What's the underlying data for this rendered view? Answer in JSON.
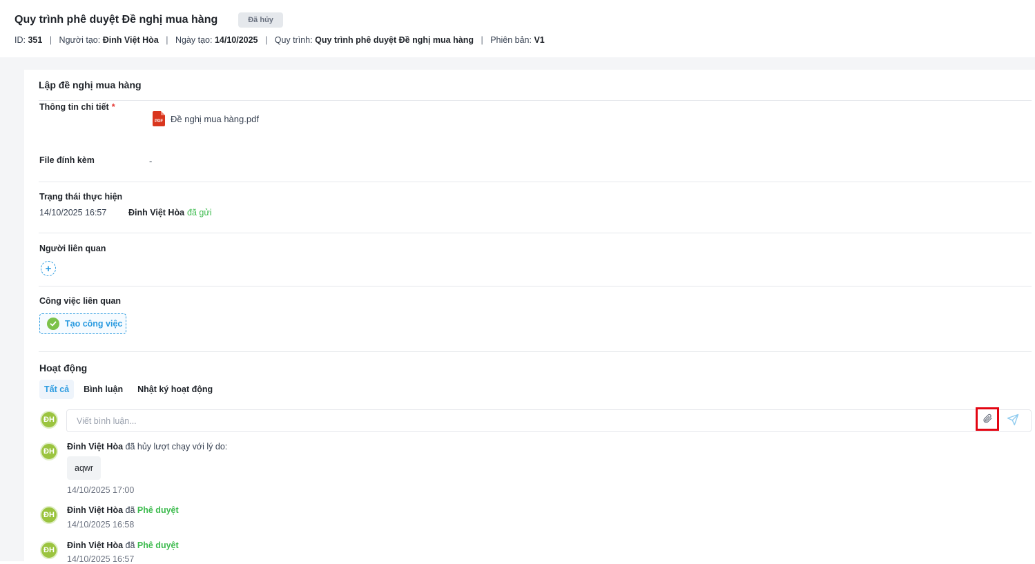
{
  "header": {
    "title": "Quy trình phê duyệt Đề nghị mua hàng",
    "status_badge": "Đã hủy",
    "meta": {
      "id_label": "ID:",
      "id_value": "351",
      "creator_label": "Người tạo:",
      "creator_value": "Đinh Việt Hòa",
      "created_label": "Ngày tạo:",
      "created_value": "14/10/2025",
      "process_label": "Quy trình:",
      "process_value": "Quy trình phê duyệt Đề nghị mua hàng",
      "version_label": "Phiên bản:",
      "version_value": "V1",
      "separator": "|"
    }
  },
  "form": {
    "section_title": "Lập đề nghị mua hàng",
    "details_label": "Thông tin chi tiết",
    "required_mark": "*",
    "details_file": "Đề nghị mua hàng.pdf",
    "pdf_icon_text": "PDF",
    "attachments_label": "File đính kèm",
    "attachments_value": "-"
  },
  "execution_status": {
    "label": "Trạng thái thực hiện",
    "time": "14/10/2025 16:57",
    "user": "Đinh Việt Hòa",
    "action": "đã gửi"
  },
  "related_people": {
    "label": "Người liên quan",
    "add_symbol": "+"
  },
  "related_tasks": {
    "label": "Công việc liên quan",
    "create_button": "Tạo công việc"
  },
  "activity": {
    "title": "Hoạt động",
    "tabs": [
      "Tất cả",
      "Bình luận",
      "Nhật ký hoạt động"
    ],
    "active_tab": "Tất cả",
    "avatar_initials": "ĐH",
    "comment_placeholder": "Viết bình luận...",
    "entries": [
      {
        "user": "Đinh Việt Hòa",
        "text": "đã hủy lượt chạy với lý do:",
        "reason": "aqwr",
        "time": "14/10/2025 17:00"
      },
      {
        "user": "Đinh Việt Hòa",
        "text": "đã",
        "action": "Phê duyệt",
        "time": "14/10/2025 16:58"
      },
      {
        "user": "Đinh Việt Hòa",
        "text": "đã",
        "action": "Phê duyệt",
        "time": "14/10/2025 16:57"
      }
    ]
  },
  "colors": {
    "accent": "#2b9be0",
    "success": "#3dbb4e",
    "avatar": "#9bc43f",
    "highlight": "#e30613",
    "pdf": "#d9361e"
  },
  "icons": [
    "pdf-icon",
    "plus-icon",
    "check-circle-icon",
    "paperclip-icon",
    "send-icon"
  ]
}
